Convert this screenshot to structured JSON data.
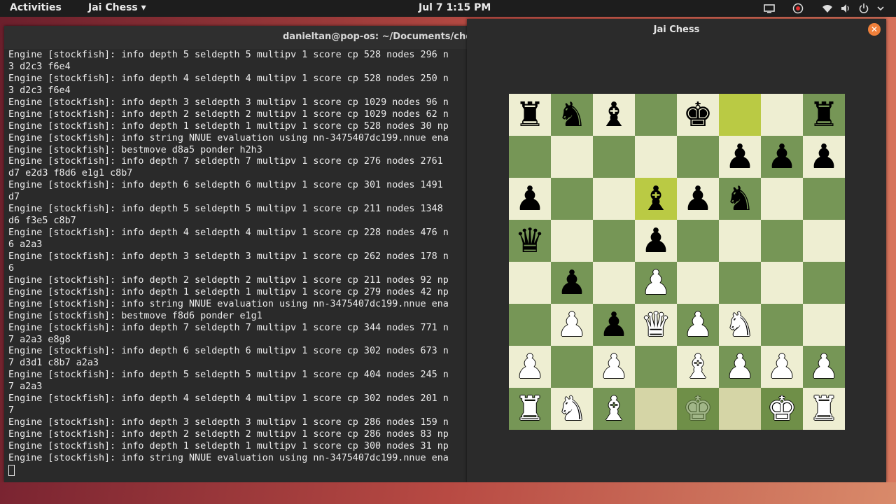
{
  "topbar": {
    "activities": "Activities",
    "app_menu": "Jai Chess ▾",
    "clock": "Jul 7   1:15 PM",
    "tray_icons": [
      "screen-icon",
      "record-icon",
      "wifi-icon",
      "volume-icon",
      "power-icon"
    ]
  },
  "terminal": {
    "title": "danieltan@pop-os: ~/Documents/chess",
    "lines": [
      "Engine [stockfish]: info depth 5 seldepth 5 multipv 1 score cp 528 nodes 296 n",
      "3 d2c3 f6e4",
      "Engine [stockfish]: info depth 4 seldepth 4 multipv 1 score cp 528 nodes 250 n",
      "3 d2c3 f6e4",
      "Engine [stockfish]: info depth 3 seldepth 3 multipv 1 score cp 1029 nodes 96 n",
      "Engine [stockfish]: info depth 2 seldepth 2 multipv 1 score cp 1029 nodes 62 n",
      "Engine [stockfish]: info depth 1 seldepth 1 multipv 1 score cp 528 nodes 30 np",
      "Engine [stockfish]: info string NNUE evaluation using nn-3475407dc199.nnue ena",
      "Engine [stockfish]: bestmove d8a5 ponder h2h3",
      "Engine [stockfish]: info depth 7 seldepth 7 multipv 1 score cp 276 nodes 2761",
      "d7 e2d3 f8d6 e1g1 c8b7",
      "Engine [stockfish]: info depth 6 seldepth 6 multipv 1 score cp 301 nodes 1491",
      "d7",
      "Engine [stockfish]: info depth 5 seldepth 5 multipv 1 score cp 211 nodes 1348",
      "d6 f3e5 c8b7",
      "Engine [stockfish]: info depth 4 seldepth 4 multipv 1 score cp 228 nodes 476 n",
      "6 a2a3",
      "Engine [stockfish]: info depth 3 seldepth 3 multipv 1 score cp 262 nodes 178 n",
      "6",
      "Engine [stockfish]: info depth 2 seldepth 2 multipv 1 score cp 211 nodes 92 np",
      "Engine [stockfish]: info depth 1 seldepth 1 multipv 1 score cp 279 nodes 42 np",
      "Engine [stockfish]: info string NNUE evaluation using nn-3475407dc199.nnue ena",
      "Engine [stockfish]: bestmove f8d6 ponder e1g1",
      "Engine [stockfish]: info depth 7 seldepth 7 multipv 1 score cp 344 nodes 771 n",
      "7 a2a3 e8g8",
      "Engine [stockfish]: info depth 6 seldepth 6 multipv 1 score cp 302 nodes 673 n",
      "7 d3d1 c8b7 a2a3",
      "Engine [stockfish]: info depth 5 seldepth 5 multipv 1 score cp 404 nodes 245 n",
      "7 a2a3",
      "Engine [stockfish]: info depth 4 seldepth 4 multipv 1 score cp 302 nodes 201 n",
      "7",
      "Engine [stockfish]: info depth 3 seldepth 3 multipv 1 score cp 286 nodes 159 n",
      "Engine [stockfish]: info depth 2 seldepth 2 multipv 1 score cp 286 nodes 83 np",
      "Engine [stockfish]: info depth 1 seldepth 1 multipv 1 score cp 300 nodes 31 np",
      "Engine [stockfish]: info string NNUE evaluation using nn-3475407dc199.nnue ena"
    ]
  },
  "chess": {
    "title": "Jai Chess",
    "close_icon": "close-icon",
    "colors": {
      "light": "#eeeed2",
      "dark": "#769656",
      "highlight": "#baca44"
    },
    "ranks": [
      [
        "br",
        "bn",
        "bb",
        "",
        "bk",
        "",
        "",
        "br"
      ],
      [
        "",
        "",
        "",
        "",
        "",
        "bp",
        "bp",
        "bp"
      ],
      [
        "bp",
        "",
        "",
        "bb",
        "bp",
        "bn",
        "",
        ""
      ],
      [
        "bq",
        "",
        "",
        "bp",
        "",
        "",
        "",
        ""
      ],
      [
        "",
        "bp",
        "",
        "wp",
        "",
        "",
        "",
        ""
      ],
      [
        "",
        "wp",
        "bp",
        "wq",
        "wp",
        "wn",
        "",
        ""
      ],
      [
        "wp",
        "",
        "wp",
        "",
        "wb",
        "wp",
        "wp",
        "wp"
      ],
      [
        "wr",
        "wn",
        "wb",
        "",
        "wk*",
        "",
        "wk",
        "wr"
      ]
    ],
    "highlights": [
      {
        "rank": 0,
        "file": 5,
        "type": "hl"
      },
      {
        "rank": 2,
        "file": 3,
        "type": "hl"
      },
      {
        "rank": 7,
        "file": 3,
        "type": "hlw"
      },
      {
        "rank": 7,
        "file": 4,
        "type": "hld"
      },
      {
        "rank": 7,
        "file": 5,
        "type": "hlw"
      },
      {
        "rank": 7,
        "file": 6,
        "type": "hld"
      }
    ]
  }
}
